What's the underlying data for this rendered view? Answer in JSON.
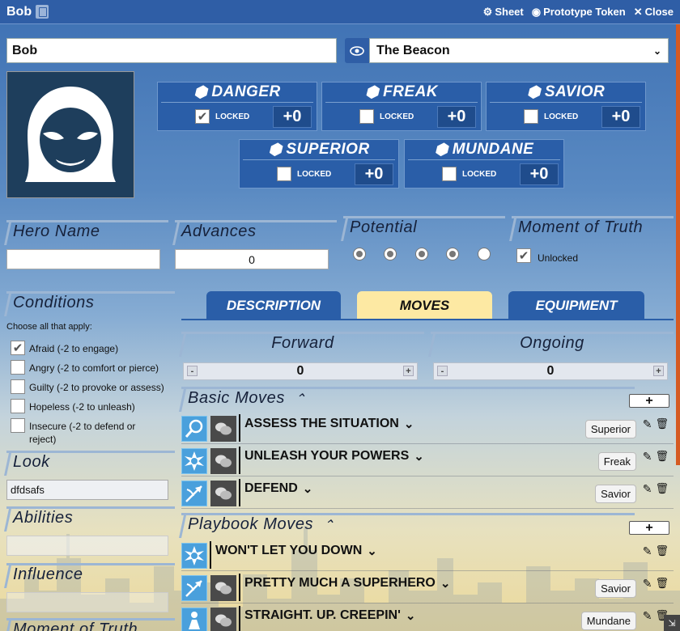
{
  "window": {
    "title": "Bob",
    "sheet_label": "Sheet",
    "token_label": "Prototype Token",
    "close_label": "Close"
  },
  "character": {
    "name": "Bob",
    "playbook": "The Beacon"
  },
  "labels": [
    {
      "name": "DANGER",
      "locked": true,
      "locked_label": "LOCKED",
      "modifier": "+0"
    },
    {
      "name": "FREAK",
      "locked": false,
      "locked_label": "LOCKED",
      "modifier": "+0"
    },
    {
      "name": "SAVIOR",
      "locked": false,
      "locked_label": "LOCKED",
      "modifier": "+0"
    },
    {
      "name": "SUPERIOR",
      "locked": false,
      "locked_label": "LOCKED",
      "modifier": "+0"
    },
    {
      "name": "MUNDANE",
      "locked": false,
      "locked_label": "LOCKED",
      "modifier": "+0"
    }
  ],
  "hero_name": {
    "title": "Hero Name",
    "value": ""
  },
  "advances": {
    "title": "Advances",
    "value": "0"
  },
  "potential": {
    "title": "Potential",
    "filled": [
      false,
      false,
      false,
      false,
      false
    ]
  },
  "moment_of_truth": {
    "title": "Moment of Truth",
    "checked": true,
    "label": "Unlocked"
  },
  "conditions": {
    "title": "Conditions",
    "hint": "Choose all that apply:",
    "items": [
      {
        "label": "Afraid (-2 to engage)",
        "checked": true
      },
      {
        "label": "Angry (-2 to comfort or pierce)",
        "checked": false
      },
      {
        "label": "Guilty (-2 to provoke or assess)",
        "checked": false
      },
      {
        "label": "Hopeless (-2 to unleash)",
        "checked": false
      },
      {
        "label": "Insecure (-2 to defend or",
        "label2": "reject)",
        "checked": false
      }
    ]
  },
  "look": {
    "title": "Look",
    "value": "dfdsafs"
  },
  "abilities": {
    "title": "Abilities",
    "value": ""
  },
  "influence": {
    "title": "Influence",
    "value": ""
  },
  "moment_section": {
    "title": "Moment of Truth"
  },
  "tabs": [
    "DESCRIPTION",
    "MOVES",
    "EQUIPMENT"
  ],
  "active_tab": "MOVES",
  "forward": {
    "title": "Forward",
    "value": "0",
    "minus": "-",
    "plus": "+"
  },
  "ongoing": {
    "title": "Ongoing",
    "value": "0",
    "minus": "-",
    "plus": "+"
  },
  "basic_moves": {
    "title": "Basic Moves",
    "add": "+",
    "items": [
      {
        "name": "ASSESS THE SITUATION",
        "tag": "Superior",
        "icon": "magnifier-icon"
      },
      {
        "name": "UNLEASH YOUR POWERS",
        "tag": "Freak",
        "icon": "power-burst-icon"
      },
      {
        "name": "DEFEND",
        "tag": "Savior",
        "icon": "shield-arrow-icon"
      }
    ]
  },
  "playbook_moves": {
    "title": "Playbook Moves",
    "add": "+",
    "items": [
      {
        "name": "WON'T LET YOU DOWN",
        "tag": "",
        "icon": "power-burst-icon",
        "has_chat": false
      },
      {
        "name": "PRETTY MUCH A SUPERHERO",
        "tag": "Savior",
        "icon": "shield-arrow-icon",
        "has_chat": true
      },
      {
        "name": "STRAIGHT. UP. CREEPIN'",
        "tag": "Mundane",
        "icon": "sneak-icon",
        "has_chat": true
      }
    ]
  },
  "colors": {
    "accent": "#2a5ea8",
    "active_tab": "#fde9a3",
    "scrollbar": "#d55a22"
  }
}
